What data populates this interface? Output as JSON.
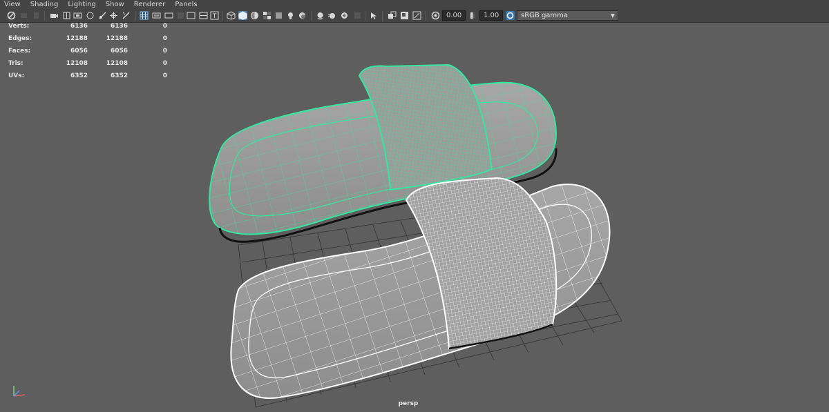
{
  "menu": [
    "View",
    "Shading",
    "Lighting",
    "Show",
    "Renderer",
    "Panels"
  ],
  "toolbar": {
    "exposure": "0.00",
    "gamma": "1.00",
    "color_space": "sRGB gamma"
  },
  "hud": {
    "rows": [
      {
        "label": "Verts:",
        "values": [
          "6136",
          "6136",
          "0"
        ]
      },
      {
        "label": "Edges:",
        "values": [
          "12188",
          "12188",
          "0"
        ]
      },
      {
        "label": "Faces:",
        "values": [
          "6056",
          "6056",
          "0"
        ]
      },
      {
        "label": "Tris:",
        "values": [
          "12108",
          "12108",
          "0"
        ]
      },
      {
        "label": "UVs:",
        "values": [
          "6352",
          "6352",
          "0"
        ]
      }
    ]
  },
  "viewport": {
    "camera": "persp",
    "colors": {
      "background": "#5e5e5e",
      "selected_wire": "#35e6a0",
      "unselected_wire": "#ffffff",
      "grid": "#3a3a3a"
    }
  }
}
